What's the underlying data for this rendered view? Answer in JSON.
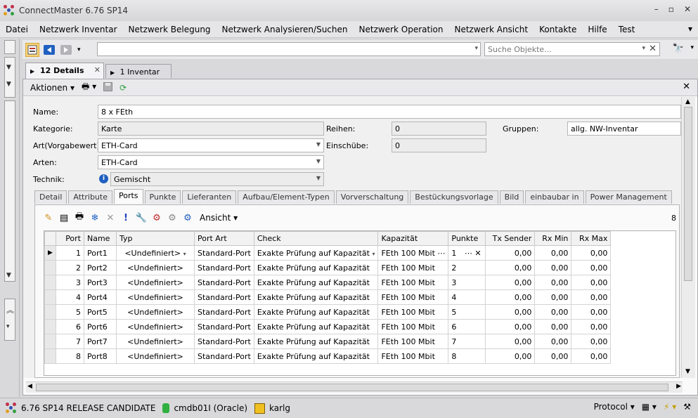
{
  "window": {
    "title": "ConnectMaster 6.76 SP14"
  },
  "menu": [
    "Datei",
    "Netzwerk Inventar",
    "Netzwerk Belegung",
    "Netzwerk Analysieren/Suchen",
    "Netzwerk Operation",
    "Netzwerk Ansicht",
    "Kontakte",
    "Hilfe",
    "Test"
  ],
  "toolbar": {
    "search_placeholder": "Suche Objekte..."
  },
  "doc_tabs": [
    {
      "label": "12 Details"
    },
    {
      "label": "1 Inventar"
    }
  ],
  "actions": {
    "label": "Aktionen"
  },
  "form": {
    "name_label": "Name:",
    "name_value": "8 x FEth",
    "kategorie_label": "Kategorie:",
    "kategorie_value": "Karte",
    "art_label": "Art(Vorgabewert):",
    "art_value": "ETH-Card",
    "arten_label": "Arten:",
    "arten_value": "ETH-Card",
    "technik_label": "Technik:",
    "technik_value": "Gemischt",
    "reihen_label": "Reihen:",
    "reihen_value": "0",
    "einschuebe_label": "Einschübe:",
    "einschuebe_value": "0",
    "gruppen_label": "Gruppen:",
    "gruppen_value": "allg. NW-Inventar"
  },
  "sub_tabs": [
    "Detail",
    "Attribute",
    "Ports",
    "Punkte",
    "Lieferanten",
    "Aufbau/Element-Typen",
    "Vorverschaltung",
    "Bestückungsvorlage",
    "Bild",
    "einbaubar in",
    "Power Management"
  ],
  "active_sub_tab": "Ports",
  "grid": {
    "view_label": "Ansicht",
    "count": "8",
    "columns": [
      "Port",
      "Name",
      "Typ",
      "Port Art",
      "Check",
      "Kapazität",
      "Punkte",
      "Tx Sender",
      "Rx Min",
      "Rx Max"
    ],
    "rows": [
      {
        "port": "1",
        "name": "Port1",
        "typ": "<Undefiniert>",
        "art": "Standard-Port",
        "check": "Exakte Prüfung auf Kapazität",
        "kap": "FEth 100 Mbit",
        "punkte": "1",
        "tx": "0,00",
        "rxmin": "0,00",
        "rxmax": "0,00"
      },
      {
        "port": "2",
        "name": "Port2",
        "typ": "<Undefiniert>",
        "art": "Standard-Port",
        "check": "Exakte Prüfung auf Kapazität",
        "kap": "FEth 100 Mbit",
        "punkte": "2",
        "tx": "0,00",
        "rxmin": "0,00",
        "rxmax": "0,00"
      },
      {
        "port": "3",
        "name": "Port3",
        "typ": "<Undefiniert>",
        "art": "Standard-Port",
        "check": "Exakte Prüfung auf Kapazität",
        "kap": "FEth 100 Mbit",
        "punkte": "3",
        "tx": "0,00",
        "rxmin": "0,00",
        "rxmax": "0,00"
      },
      {
        "port": "4",
        "name": "Port4",
        "typ": "<Undefiniert>",
        "art": "Standard-Port",
        "check": "Exakte Prüfung auf Kapazität",
        "kap": "FEth 100 Mbit",
        "punkte": "4",
        "tx": "0,00",
        "rxmin": "0,00",
        "rxmax": "0,00"
      },
      {
        "port": "5",
        "name": "Port5",
        "typ": "<Undefiniert>",
        "art": "Standard-Port",
        "check": "Exakte Prüfung auf Kapazität",
        "kap": "FEth 100 Mbit",
        "punkte": "5",
        "tx": "0,00",
        "rxmin": "0,00",
        "rxmax": "0,00"
      },
      {
        "port": "6",
        "name": "Port6",
        "typ": "<Undefiniert>",
        "art": "Standard-Port",
        "check": "Exakte Prüfung auf Kapazität",
        "kap": "FEth 100 Mbit",
        "punkte": "6",
        "tx": "0,00",
        "rxmin": "0,00",
        "rxmax": "0,00"
      },
      {
        "port": "7",
        "name": "Port7",
        "typ": "<Undefiniert>",
        "art": "Standard-Port",
        "check": "Exakte Prüfung auf Kapazität",
        "kap": "FEth 100 Mbit",
        "punkte": "7",
        "tx": "0,00",
        "rxmin": "0,00",
        "rxmax": "0,00"
      },
      {
        "port": "8",
        "name": "Port8",
        "typ": "<Undefiniert>",
        "art": "Standard-Port",
        "check": "Exakte Prüfung auf Kapazität",
        "kap": "FEth 100 Mbit",
        "punkte": "8",
        "tx": "0,00",
        "rxmin": "0,00",
        "rxmax": "0,00"
      }
    ]
  },
  "status": {
    "version": "6.76 SP14 RELEASE CANDIDATE",
    "db": "cmdb01I (Oracle)",
    "user": "karlg",
    "protocol": "Protocol"
  },
  "icons": {
    "logo_colors": [
      "#c0304a",
      "#3050b0",
      "#e0a020",
      "#30a040"
    ],
    "accent": "#2060c0"
  }
}
